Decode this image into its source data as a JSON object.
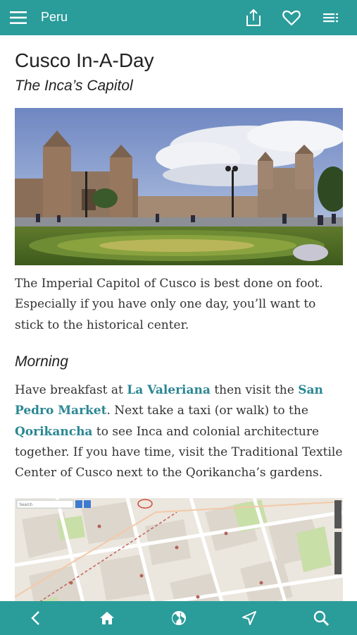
{
  "header": {
    "title": "Peru"
  },
  "article": {
    "title": "Cusco In-A-Day",
    "subtitle": "The Inca’s Capitol",
    "intro": "The Imperial Capitol of Cusco is best done on foot. Especially if you have only one day, you’ll want to stick to the historical center.",
    "morning_heading": "Morning",
    "morning": {
      "t1": "Have breakfast at ",
      "link1": "La Valeriana",
      "t2": " then visit the ",
      "link2": "San Pedro Market",
      "t3": ". Next take a taxi (or walk) to the ",
      "link3": "Qorikancha",
      "t4": " to see Inca and colonial architecture together. If you have time, visit the Traditional Textile Center of Cusco next to the Qorikancha’s gardens."
    },
    "map": {
      "search_placeholder": "Search"
    }
  },
  "colors": {
    "bar": "#2a9c9a",
    "link": "#2a8793"
  }
}
